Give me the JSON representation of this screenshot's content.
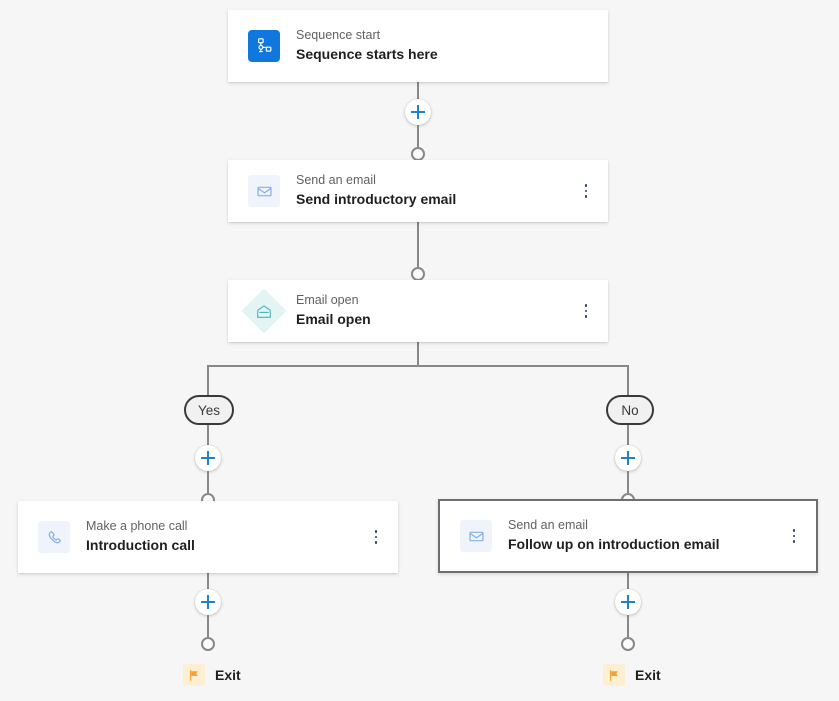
{
  "canvas": {
    "background": "#f6f6f6",
    "accent_blue": "#0f77dd",
    "line_color": "#8a8886",
    "exit_flag_color": "#f0a33c"
  },
  "nodes": {
    "start": {
      "subtitle": "Sequence start",
      "title": "Sequence starts here",
      "icon": "sequence-start-icon"
    },
    "send_intro_email": {
      "subtitle": "Send an email",
      "title": "Send introductory email",
      "icon": "email-icon"
    },
    "email_open": {
      "subtitle": "Email open",
      "title": "Email open",
      "icon": "email-open-icon"
    },
    "intro_call": {
      "subtitle": "Make a phone call",
      "title": "Introduction call",
      "icon": "phone-icon"
    },
    "follow_up_email": {
      "subtitle": "Send an email",
      "title": "Follow up on introduction email",
      "icon": "email-icon",
      "selected": true
    }
  },
  "branches": {
    "yes_label": "Yes",
    "no_label": "No"
  },
  "exits": {
    "left_label": "Exit",
    "right_label": "Exit",
    "icon": "flag-icon"
  },
  "controls": {
    "add_label": "+",
    "menu_label": "More options"
  }
}
